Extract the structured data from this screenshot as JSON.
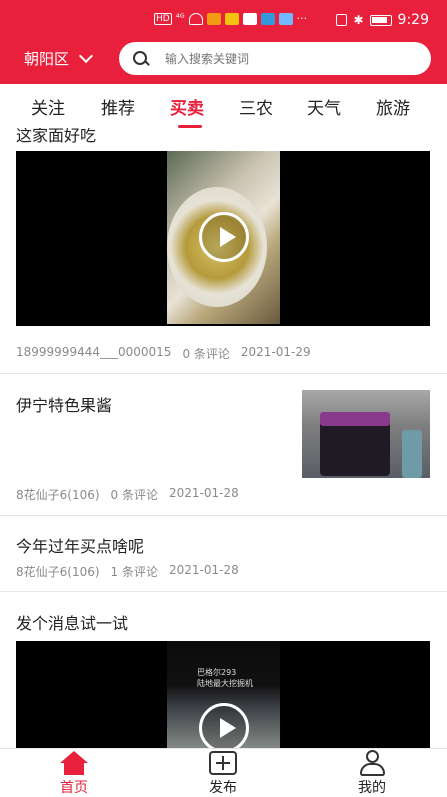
{
  "status_bar": {
    "left": "HD",
    "signal": "⁴ᴳ",
    "time": "9:29"
  },
  "header": {
    "location": "朝阳区",
    "search_placeholder": "输入搜索关键词"
  },
  "tabs": [
    {
      "label": "关注",
      "active": false
    },
    {
      "label": "推荐",
      "active": false
    },
    {
      "label": "买卖",
      "active": true
    },
    {
      "label": "三农",
      "active": false
    },
    {
      "label": "天气",
      "active": false
    },
    {
      "label": "旅游",
      "active": false
    }
  ],
  "feed": {
    "cut_title": "这家面好吃",
    "items": [
      {
        "author": "18999999444___0000015",
        "comments": "0 条评论",
        "date": "2021-01-29"
      },
      {
        "title": "伊宁特色果酱",
        "author": "8花仙子6(106)",
        "comments": "0 条评论",
        "date": "2021-01-28"
      },
      {
        "title": "今年过年买点啥呢",
        "author": "8花仙子6(106)",
        "comments": "1 条评论",
        "date": "2021-01-28"
      },
      {
        "title": "发个消息试一试",
        "video_caption_line1": "巴格尔293",
        "video_caption_line2": "陆地最大挖掘机"
      }
    ]
  },
  "bottom_nav": [
    {
      "label": "首页",
      "icon": "home-icon",
      "active": true,
      "color": "#e8203b"
    },
    {
      "label": "发布",
      "icon": "plus-icon",
      "active": false,
      "color": "#222222"
    },
    {
      "label": "我的",
      "icon": "user-icon",
      "active": false,
      "color": "#222222"
    }
  ],
  "colors": {
    "brand": "#e8203b"
  }
}
